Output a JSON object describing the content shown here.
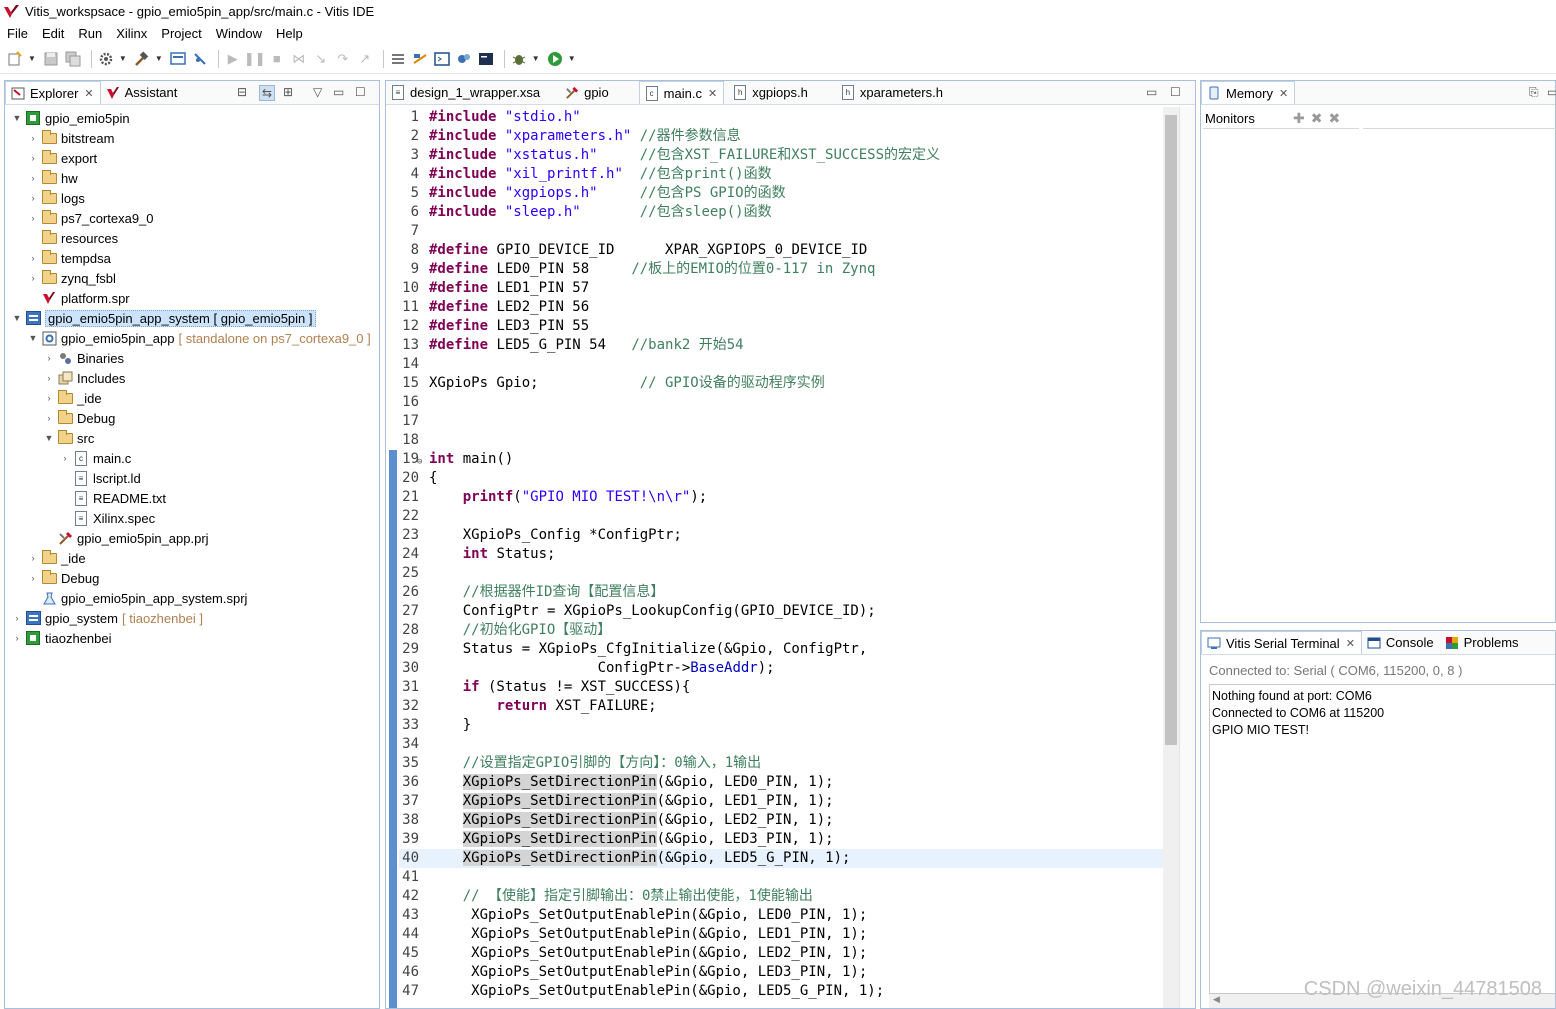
{
  "window": {
    "title": "Vitis_workspsace - gpio_emio5pin_app/src/main.c - Vitis IDE"
  },
  "menu": [
    "File",
    "Edit",
    "Run",
    "Xilinx",
    "Project",
    "Window",
    "Help"
  ],
  "explorer": {
    "tabs": [
      {
        "label": "Explorer"
      },
      {
        "label": "Assistant"
      }
    ],
    "tree": [
      {
        "label": "gpio_emio5pin",
        "deco": ""
      },
      {
        "label": "bitstream",
        "deco": ""
      },
      {
        "label": "export",
        "deco": ""
      },
      {
        "label": "hw",
        "deco": ""
      },
      {
        "label": "logs",
        "deco": ""
      },
      {
        "label": "ps7_cortexa9_0",
        "deco": ""
      },
      {
        "label": "resources",
        "deco": ""
      },
      {
        "label": "tempdsa",
        "deco": ""
      },
      {
        "label": "zynq_fsbl",
        "deco": ""
      },
      {
        "label": "platform.spr",
        "deco": ""
      },
      {
        "label": "gpio_emio5pin_app_system [ gpio_emio5pin ]",
        "deco": ""
      },
      {
        "label": "gpio_emio5pin_app",
        "deco": "[ standalone on ps7_cortexa9_0 ]"
      },
      {
        "label": "Binaries",
        "deco": ""
      },
      {
        "label": "Includes",
        "deco": ""
      },
      {
        "label": "_ide",
        "deco": ""
      },
      {
        "label": "Debug",
        "deco": ""
      },
      {
        "label": "src",
        "deco": ""
      },
      {
        "label": "main.c",
        "deco": ""
      },
      {
        "label": "lscript.ld",
        "deco": ""
      },
      {
        "label": "README.txt",
        "deco": ""
      },
      {
        "label": "Xilinx.spec",
        "deco": ""
      },
      {
        "label": "gpio_emio5pin_app.prj",
        "deco": ""
      },
      {
        "label": "_ide",
        "deco": ""
      },
      {
        "label": "Debug",
        "deco": ""
      },
      {
        "label": "gpio_emio5pin_app_system.sprj",
        "deco": ""
      },
      {
        "label": "gpio_system",
        "deco": "[ tiaozhenbei ]"
      },
      {
        "label": "tiaozhenbei",
        "deco": ""
      }
    ]
  },
  "editor": {
    "tabs": [
      {
        "label": "design_1_wrapper.xsa"
      },
      {
        "label": "gpio"
      },
      {
        "label": "main.c"
      },
      {
        "label": "xgpiops.h"
      },
      {
        "label": "xparameters.h"
      }
    ],
    "lines": [
      "1",
      "2",
      "3",
      "4",
      "5",
      "6",
      "7",
      "8",
      "9",
      "10",
      "11",
      "12",
      "13",
      "14",
      "15",
      "16",
      "17",
      "18",
      "19",
      "20",
      "21",
      "22",
      "23",
      "24",
      "25",
      "26",
      "27",
      "28",
      "29",
      "30",
      "31",
      "32",
      "33",
      "34",
      "35",
      "36",
      "37",
      "38",
      "39",
      "40",
      "41",
      "42",
      "43",
      "44",
      "45",
      "46",
      "47"
    ],
    "code": {
      "l1": [
        "#include",
        " ",
        "\"stdio.h\""
      ],
      "l2": [
        "#include",
        " ",
        "\"xparameters.h\"",
        " //器件参数信息"
      ],
      "l3": [
        "#include",
        " ",
        "\"xstatus.h\"",
        "     //包含XST_FAILURE和XST_SUCCESS的宏定义"
      ],
      "l4": [
        "#include",
        " ",
        "\"xil_printf.h\"",
        "  //包含print()函数"
      ],
      "l5": [
        "#include",
        " ",
        "\"xgpiops.h\"",
        "     //包含PS GPIO的函数"
      ],
      "l6": [
        "#include",
        " ",
        "\"sleep.h\"",
        "       //包含sleep()函数"
      ],
      "l8": [
        "#define",
        " GPIO_DEVICE_ID      XPAR_XGPIOPS_0_DEVICE_ID"
      ],
      "l9": [
        "#define",
        " LED0_PIN 58     ",
        "//板上的EMIO的位置0-117 in Zynq"
      ],
      "l10": [
        "#define",
        " LED1_PIN 57"
      ],
      "l11": [
        "#define",
        " LED2_PIN 56"
      ],
      "l12": [
        "#define",
        " LED3_PIN 55"
      ],
      "l13": [
        "#define",
        " LED5_G_PIN 54   ",
        "//bank2 开始54"
      ],
      "l15": [
        "XGpioPs Gpio;            ",
        "// GPIO设备的驱动程序实例"
      ],
      "l19": [
        "int",
        " main()"
      ],
      "l20": [
        "{"
      ],
      "l21": [
        "    ",
        "printf",
        "(",
        "\"GPIO MIO TEST!\\n\\r\"",
        ");"
      ],
      "l23": [
        "    XGpioPs_Config *ConfigPtr;"
      ],
      "l24": [
        "    ",
        "int",
        " Status;"
      ],
      "l26": [
        "    ",
        "//根据器件ID查询【配置信息】"
      ],
      "l27": [
        "    ConfigPtr = XGpioPs_LookupConfig(GPIO_DEVICE_ID);"
      ],
      "l28": [
        "    ",
        "//初始化GPIO【驱动】"
      ],
      "l29": [
        "    Status = XGpioPs_CfgInitialize(&Gpio, ConfigPtr,"
      ],
      "l30": [
        "                    ConfigPtr->",
        "BaseAddr",
        ");"
      ],
      "l31": [
        "    ",
        "if",
        " (Status != XST_SUCCESS){"
      ],
      "l32": [
        "        ",
        "return",
        " XST_FAILURE;"
      ],
      "l33": [
        "    }"
      ],
      "l35": [
        "    ",
        "//设置指定GPIO引脚的【方向】：0输入，1输出"
      ],
      "l36": [
        "    ",
        "XGpioPs_SetDirectionPin",
        "(&Gpio, LED0_PIN, 1);"
      ],
      "l37": [
        "    ",
        "XGpioPs_SetDirectionPin",
        "(&Gpio, LED1_PIN, 1);"
      ],
      "l38": [
        "    ",
        "XGpioPs_SetDirectionPin",
        "(&Gpio, LED2_PIN, 1);"
      ],
      "l39": [
        "    ",
        "XGpioPs_SetDirectionPin",
        "(&Gpio, LED3_PIN, 1);"
      ],
      "l40": [
        "    ",
        "XGpioPs_SetDirectionPin",
        "(&Gpio, LED5_G_PIN, 1);"
      ],
      "l42": [
        "    ",
        "// 【使能】指定引脚输出：0禁止输出使能，1使能输出"
      ],
      "l43": [
        "     XGpioPs_SetOutputEnablePin(&Gpio, LED0_PIN, 1);"
      ],
      "l44": [
        "     XGpioPs_SetOutputEnablePin(&Gpio, LED1_PIN, 1);"
      ],
      "l45": [
        "     XGpioPs_SetOutputEnablePin(&Gpio, LED2_PIN, 1);"
      ],
      "l46": [
        "     XGpioPs_SetOutputEnablePin(&Gpio, LED3_PIN, 1);"
      ],
      "l47": [
        "     XGpioPs_SetOutputEnablePin(&Gpio, LED5_G_PIN, 1);"
      ]
    }
  },
  "memory": {
    "tab_label": "Memory",
    "monitors_label": "Monitors"
  },
  "terminal": {
    "tabs": [
      {
        "label": "Vitis Serial Terminal"
      },
      {
        "label": "Console"
      },
      {
        "label": "Problems"
      }
    ],
    "status": "Connected to: Serial (  COM6, 115200, 0, 8 )",
    "output": [
      "Nothing found at port: COM6",
      "Connected to COM6 at 115200",
      "GPIO MIO TEST!"
    ]
  },
  "watermark": "CSDN @weixin_44781508",
  "colors": {
    "keyword": "#7f0055",
    "string": "#2a00ff",
    "comment": "#3f7f5f",
    "field": "#0000c0",
    "current_line": "#e8f2fe",
    "selection": "#cce4fb"
  }
}
